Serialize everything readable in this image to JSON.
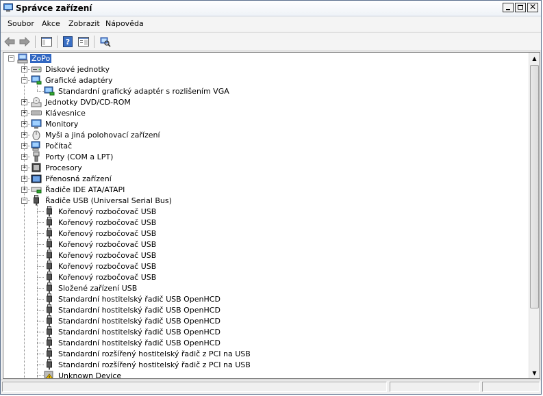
{
  "window": {
    "title": "Správce zařízení"
  },
  "menu": [
    "Soubor",
    "Akce",
    "Zobrazit",
    "Nápověda"
  ],
  "tree": {
    "root": "ZoPo",
    "nodes": [
      {
        "label": "Diskové jednotky",
        "icon": "disk-drive-icon"
      },
      {
        "label": "Grafické adaptéry",
        "icon": "display-adapter-icon"
      },
      {
        "label": "Standardní grafický adaptér s rozlišením VGA",
        "icon": "display-adapter-icon"
      },
      {
        "label": "Jednotky DVD/CD-ROM",
        "icon": "dvd-drive-icon"
      },
      {
        "label": "Klávesnice",
        "icon": "keyboard-icon"
      },
      {
        "label": "Monitory",
        "icon": "monitor-icon"
      },
      {
        "label": "Myši a jiná polohovací zařízení",
        "icon": "mouse-icon"
      },
      {
        "label": "Počítač",
        "icon": "computer-icon"
      },
      {
        "label": "Porty (COM a LPT)",
        "icon": "port-icon"
      },
      {
        "label": "Procesory",
        "icon": "processor-icon"
      },
      {
        "label": "Přenosná zařízení",
        "icon": "portable-device-icon"
      },
      {
        "label": "Řadiče IDE ATA/ATAPI",
        "icon": "ide-controller-icon"
      },
      {
        "label": "Řadiče USB (Universal Serial Bus)",
        "icon": "usb-icon"
      },
      {
        "label": "Kořenový rozbočovač USB",
        "icon": "usb-icon"
      },
      {
        "label": "Kořenový rozbočovač USB",
        "icon": "usb-icon"
      },
      {
        "label": "Kořenový rozbočovač USB",
        "icon": "usb-icon"
      },
      {
        "label": "Kořenový rozbočovač USB",
        "icon": "usb-icon"
      },
      {
        "label": "Kořenový rozbočovač USB",
        "icon": "usb-icon"
      },
      {
        "label": "Kořenový rozbočovač USB",
        "icon": "usb-icon"
      },
      {
        "label": "Kořenový rozbočovač USB",
        "icon": "usb-icon"
      },
      {
        "label": "Složené zařízení USB",
        "icon": "usb-icon"
      },
      {
        "label": "Standardní hostitelský řadič  USB OpenHCD",
        "icon": "usb-icon"
      },
      {
        "label": "Standardní hostitelský řadič  USB OpenHCD",
        "icon": "usb-icon"
      },
      {
        "label": "Standardní hostitelský řadič  USB OpenHCD",
        "icon": "usb-icon"
      },
      {
        "label": "Standardní hostitelský řadič  USB OpenHCD",
        "icon": "usb-icon"
      },
      {
        "label": "Standardní hostitelský řadič  USB OpenHCD",
        "icon": "usb-icon"
      },
      {
        "label": "Standardní rozšířený hostitelský řadič z PCI na USB",
        "icon": "usb-icon"
      },
      {
        "label": "Standardní rozšířený hostitelský řadič z PCI na USB",
        "icon": "usb-icon"
      },
      {
        "label": "Unknown Device",
        "icon": "warning-icon"
      }
    ]
  },
  "colors": {
    "selection": "#3167c2",
    "accent": "#2a4f9e"
  }
}
